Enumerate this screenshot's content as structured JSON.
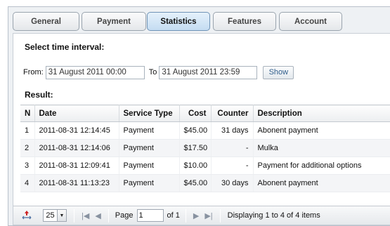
{
  "tabs": [
    {
      "label": "General",
      "active": false
    },
    {
      "label": "Payment",
      "active": false
    },
    {
      "label": "Statistics",
      "active": true
    },
    {
      "label": "Features",
      "active": false
    },
    {
      "label": "Account",
      "active": false
    }
  ],
  "filter": {
    "heading": "Select time interval:",
    "from_label": "From:",
    "from_value": "31 August 2011 00:00",
    "to_label": "To",
    "to_value": "31 August 2011 23:59",
    "show_label": "Show"
  },
  "result_heading": "Result:",
  "table": {
    "columns": [
      "N",
      "Date",
      "Service Type",
      "Cost",
      "Counter",
      "Description"
    ],
    "rows": [
      {
        "n": "1",
        "date": "2011-08-31 12:14:45",
        "service": "Payment",
        "cost": "$45.00",
        "counter": "31 days",
        "description": "Abonent payment"
      },
      {
        "n": "2",
        "date": "2011-08-31 12:14:06",
        "service": "Payment",
        "cost": "$17.50",
        "counter": "-",
        "description": "Mulka"
      },
      {
        "n": "3",
        "date": "2011-08-31 12:09:41",
        "service": "Payment",
        "cost": "$10.00",
        "counter": "-",
        "description": "Payment for additional options"
      },
      {
        "n": "4",
        "date": "2011-08-31 11:13:23",
        "service": "Payment",
        "cost": "$45.00",
        "counter": "30 days",
        "description": "Abonent payment"
      }
    ]
  },
  "pager": {
    "page_size": "25",
    "page_label": "Page",
    "page_value": "1",
    "of_label": "of 1",
    "status": "Displaying 1 to 4 of 4 items"
  },
  "icons": {
    "resize": "resize-icon",
    "first": "first-page-icon",
    "prev": "prev-page-icon",
    "next": "next-page-icon",
    "last": "last-page-icon",
    "dropdown": "dropdown-arrow-icon"
  },
  "colors": {
    "active_tab": "#c4dcf2",
    "link_blue": "#2e5c8a",
    "resize_icon": "#cc2222"
  }
}
